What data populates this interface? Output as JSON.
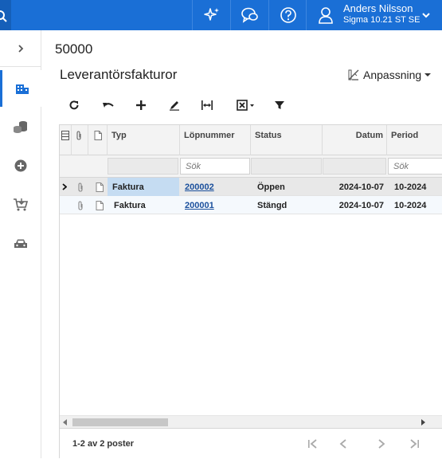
{
  "header": {
    "user_name": "Anders Nilsson",
    "user_sub": "Sigma 10.21 ST SE",
    "icons": [
      "search-icon",
      "sparkle-icon",
      "chat-icon",
      "help-icon",
      "user-icon",
      "chevron-down-icon"
    ]
  },
  "sidebar": {
    "items": [
      "expand-icon",
      "company-icon",
      "coins-icon",
      "add-circle-icon",
      "cart-icon",
      "car-icon"
    ]
  },
  "page": {
    "company": "50000",
    "title": "Leverantörsfakturor",
    "customize_label": "Anpassning"
  },
  "toolbar": {
    "icons": [
      "refresh-icon",
      "undo-icon",
      "add-icon",
      "edit-icon",
      "fit-columns-icon",
      "export-icon",
      "filter-icon"
    ]
  },
  "grid": {
    "columns": {
      "typ": "Typ",
      "lopnummer": "Löpnummer",
      "status": "Status",
      "datum": "Datum",
      "period": "Period"
    },
    "filter_placeholder": "Sök",
    "rows": [
      {
        "typ": "Faktura",
        "lopnummer": "200002",
        "status": "Öppen",
        "datum": "2024-10-07",
        "period": "10-2024"
      },
      {
        "typ": "Faktura",
        "lopnummer": "200001",
        "status": "Stängd",
        "datum": "2024-10-07",
        "period": "10-2024"
      }
    ],
    "pager_text": "1-2 av 2 poster"
  },
  "colors": {
    "accent": "#1a6fd6",
    "link": "#1a4f9c",
    "active_cell": "#c5dcf2"
  }
}
